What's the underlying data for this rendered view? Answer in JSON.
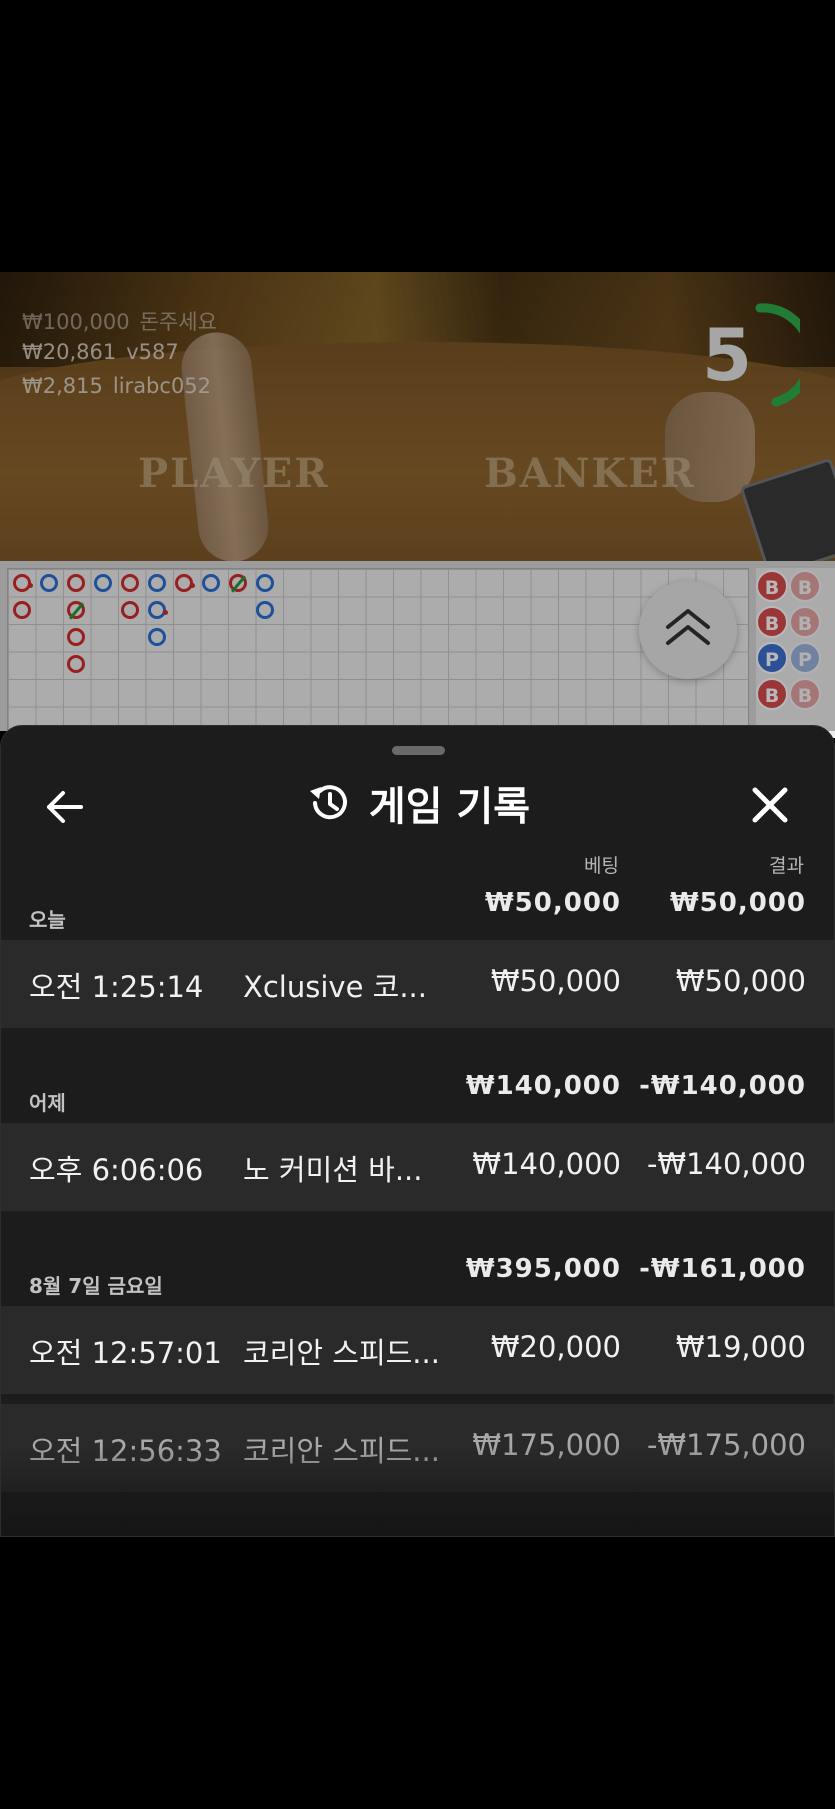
{
  "stream": {
    "winners": [
      {
        "amount": "₩100,000",
        "user": "돈주세요"
      },
      {
        "amount": "₩20,861",
        "user": "v587"
      },
      {
        "amount": "₩2,815",
        "user": "lirabc052"
      }
    ],
    "table_labels": {
      "player": "PLAYER",
      "banker": "BANKER"
    },
    "countdown": "5"
  },
  "roadmap": {
    "side_beads": [
      "B",
      "B",
      "B",
      "B",
      "P",
      "P",
      "B",
      "B"
    ]
  },
  "sheet": {
    "title": "게임 기록",
    "columns": {
      "bet": "베팅",
      "result": "결과"
    },
    "sections": [
      {
        "label": "오늘",
        "bet_total": "₩50,000",
        "result_total": "₩50,000",
        "rows": [
          {
            "time": "오전 1:25:14",
            "game": "Xclusive 코...",
            "bet": "₩50,000",
            "result": "₩50,000"
          }
        ]
      },
      {
        "label": "어제",
        "bet_total": "₩140,000",
        "result_total": "-₩140,000",
        "rows": [
          {
            "time": "오후 6:06:06",
            "game": "노 커미션 바...",
            "bet": "₩140,000",
            "result": "-₩140,000"
          }
        ]
      },
      {
        "label": "8월 7일 금요일",
        "bet_total": "₩395,000",
        "result_total": "-₩161,000",
        "rows": [
          {
            "time": "오전 12:57:01",
            "game": "코리안 스피드...",
            "bet": "₩20,000",
            "result": "₩19,000"
          },
          {
            "time": "오전 12:56:33",
            "game": "코리안 스피드...",
            "bet": "₩175,000",
            "result": "-₩175,000"
          }
        ]
      }
    ]
  },
  "colors": {
    "banker_red": "#d12b2b",
    "player_blue": "#2a6fd6",
    "tie_green": "#1f9a3a",
    "sheet_bg": "#1c1c1c"
  }
}
